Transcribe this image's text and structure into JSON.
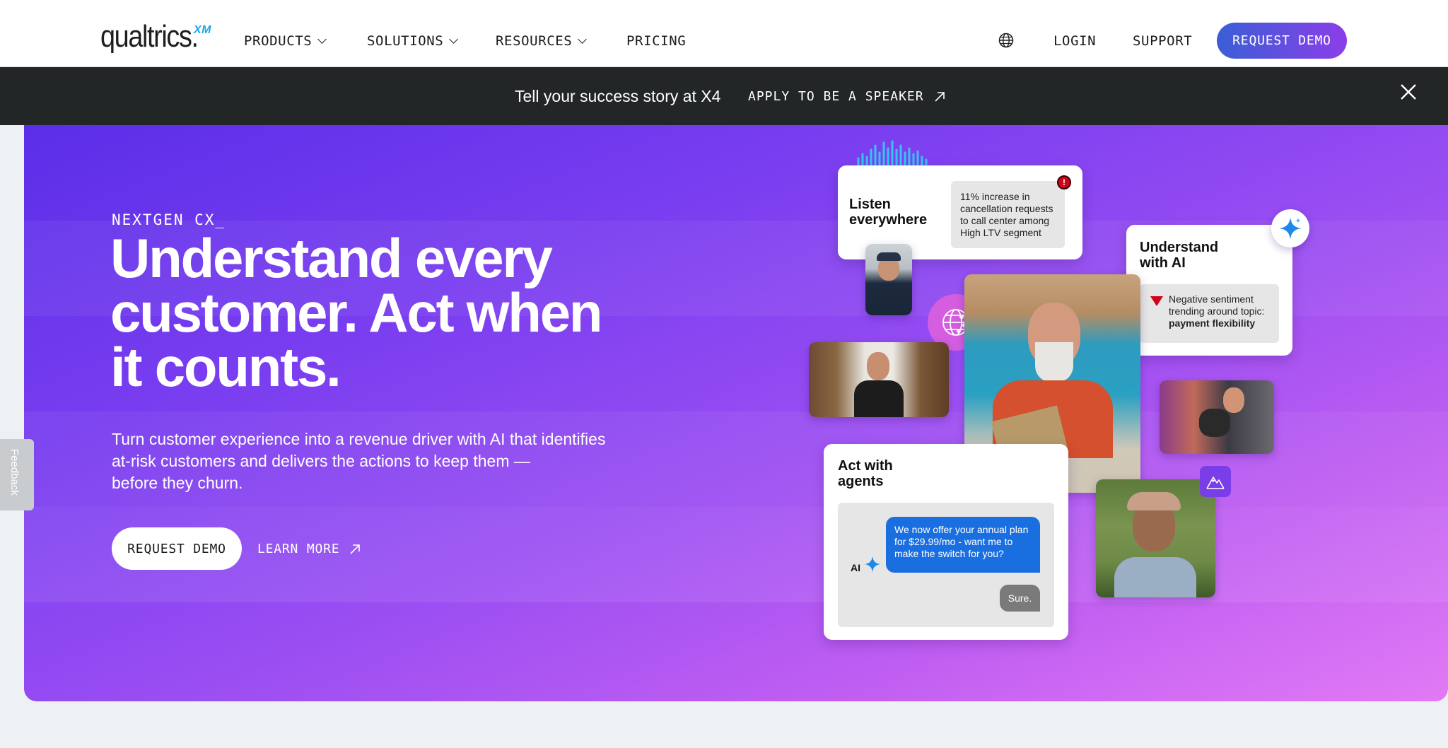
{
  "nav": {
    "logo_text": "qualtrics.",
    "logo_badge": "XM",
    "items": [
      {
        "label": "PRODUCTS"
      },
      {
        "label": "SOLUTIONS"
      },
      {
        "label": "RESOURCES"
      },
      {
        "label": "PRICING"
      }
    ],
    "login": "LOGIN",
    "support": "SUPPORT",
    "request_demo": "REQUEST DEMO"
  },
  "banner": {
    "text": "Tell your success story at X4",
    "cta": "APPLY TO BE A SPEAKER"
  },
  "hero": {
    "eyebrow": "NEXTGEN CX_",
    "headline_lines": [
      "Understand every",
      "customer. Act when",
      "it counts."
    ],
    "subtext_lines": [
      "Turn customer experience into a revenue driver with AI that identifies",
      "at-risk customers and delivers the actions to keep them —",
      "before they churn."
    ],
    "request_demo": "REQUEST DEMO",
    "learn_more": "LEARN MORE"
  },
  "feedback_tab": "Feedback",
  "cards": {
    "listen": {
      "title_lines": [
        "Listen",
        "everywhere"
      ],
      "insight_lines": [
        "11% increase in",
        "cancellation requests",
        "to call center among",
        "High LTV segment"
      ],
      "alert_icon": "!"
    },
    "understand": {
      "title_lines": [
        "Understand",
        "with AI"
      ],
      "insight_lines": [
        "Negative sentiment",
        "trending around topic:"
      ],
      "insight_bold": "payment flexibility"
    },
    "agents": {
      "title_lines": [
        "Act with",
        "agents"
      ],
      "ai_label": "AI",
      "message_lines": [
        "We now offer your annual plan",
        "for $29.99/mo - want me to",
        "make the switch for you?"
      ],
      "reply": "Sure."
    }
  },
  "colors": {
    "hero_start": "#5b2ee8",
    "hero_end": "#e27af5",
    "banner_bg": "#232626",
    "chat_blue": "#1a6fe0",
    "alert_red": "#d0021b"
  }
}
